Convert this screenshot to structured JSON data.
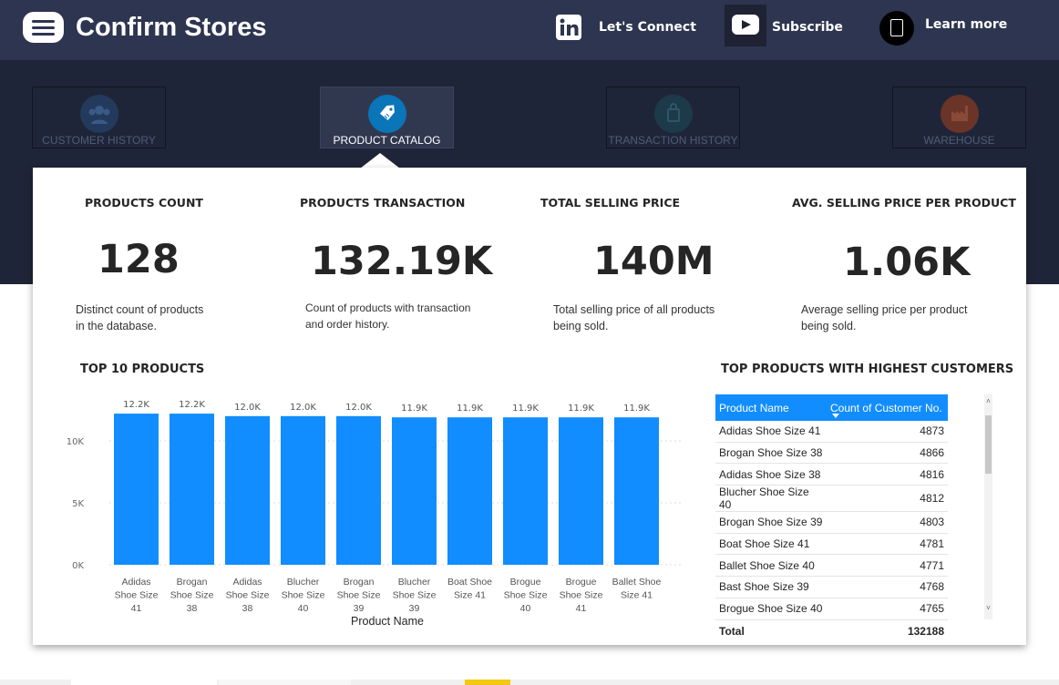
{
  "header": {
    "title": "Confirm Stores",
    "links": {
      "connect": "Let's Connect",
      "subscribe": "Subscribe",
      "learn_more": "Learn more"
    }
  },
  "nav": {
    "tabs": [
      {
        "label": "CUSTOMER HISTORY",
        "icon": "customer-group-icon",
        "active": false
      },
      {
        "label": "PRODUCT CATALOG",
        "icon": "price-tag-icon",
        "active": true
      },
      {
        "label": "TRANSACTION HISTORY",
        "icon": "shopping-bag-icon",
        "active": false
      },
      {
        "label": "WAREHOUSE",
        "icon": "factory-icon",
        "active": false
      }
    ]
  },
  "kpis": [
    {
      "title": "PRODUCTS COUNT",
      "value": "128",
      "desc1": "Distinct count of products",
      "desc2": "in the database."
    },
    {
      "title": "PRODUCTS TRANSACTION",
      "value": "132.19K",
      "desc1": "Count of products with transaction",
      "desc2": "and order history."
    },
    {
      "title": "TOTAL SELLING PRICE",
      "value": "140M",
      "desc1": "Total selling price of all products",
      "desc2": "being sold."
    },
    {
      "title": "AVG. SELLING PRICE PER PRODUCT",
      "value": "1.06K",
      "desc1": "Average selling price per product",
      "desc2": "being sold."
    }
  ],
  "chart_title": "TOP 10 PRODUCTS",
  "chart_data": {
    "type": "bar",
    "categories": [
      [
        "Adidas",
        "Shoe Size",
        "41"
      ],
      [
        "Brogan",
        "Shoe Size",
        "38"
      ],
      [
        "Adidas",
        "Shoe Size",
        "38"
      ],
      [
        "Blucher",
        "Shoe Size",
        "40"
      ],
      [
        "Brogan",
        "Shoe Size",
        "39"
      ],
      [
        "Blucher",
        "Shoe Size",
        "39"
      ],
      [
        "Boat Shoe",
        "Size 41"
      ],
      [
        "Brogue",
        "Shoe Size",
        "40"
      ],
      [
        "Brogue",
        "Shoe Size",
        "41"
      ],
      [
        "Ballet Shoe",
        "Size 41"
      ]
    ],
    "values": [
      12200,
      12200,
      12000,
      12000,
      12000,
      11900,
      11900,
      11900,
      11900,
      11900
    ],
    "data_labels": [
      "12.2K",
      "12.2K",
      "12.0K",
      "12.0K",
      "12.0K",
      "11.9K",
      "11.9K",
      "11.9K",
      "11.9K",
      "11.9K"
    ],
    "y_ticks": [
      {
        "value": 0,
        "label": "0K"
      },
      {
        "value": 5000,
        "label": "5K"
      },
      {
        "value": 10000,
        "label": "10K"
      }
    ],
    "xlabel": "Product Name",
    "ylabel": "",
    "ylim": [
      0,
      14000
    ],
    "color": "#118dff",
    "grid": true
  },
  "table": {
    "title": "TOP PRODUCTS WITH HIGHEST CUSTOMERS",
    "headers": [
      "Product Name",
      "Count of Customer No."
    ],
    "rows": [
      [
        "Adidas Shoe Size 41",
        "4873"
      ],
      [
        "Brogan Shoe Size 38",
        "4866"
      ],
      [
        "Adidas Shoe Size 38",
        "4816"
      ],
      [
        "Blucher Shoe Size 40",
        "4812"
      ],
      [
        "Brogan Shoe Size 39",
        "4803"
      ],
      [
        "Boat Shoe Size 41",
        "4781"
      ],
      [
        "Ballet Shoe Size 40",
        "4771"
      ],
      [
        "Bast Shoe Size 39",
        "4768"
      ],
      [
        "Brogue Shoe Size 40",
        "4765"
      ]
    ],
    "total": [
      "Total",
      "132188"
    ]
  }
}
